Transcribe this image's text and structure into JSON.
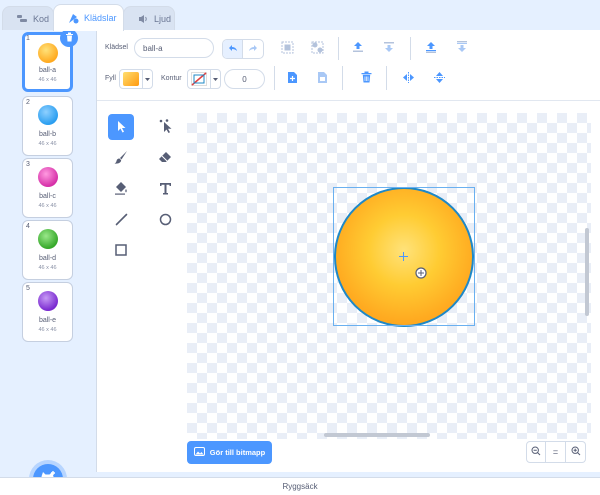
{
  "tabs": [
    {
      "label": "Kod",
      "icon": "code-icon"
    },
    {
      "label": "Klädslar",
      "icon": "costumes-icon"
    },
    {
      "label": "Ljud",
      "icon": "sound-icon"
    }
  ],
  "costumes": [
    {
      "number": "1",
      "name": "ball-a",
      "size": "46 x 46",
      "color": "#ffb21e",
      "selected": true
    },
    {
      "number": "2",
      "name": "ball-b",
      "size": "46 x 46",
      "color": "#3aaaf5",
      "selected": false
    },
    {
      "number": "3",
      "name": "ball-c",
      "size": "46 x 46",
      "color": "#e44ab8",
      "selected": false
    },
    {
      "number": "4",
      "name": "ball-d",
      "size": "46 x 46",
      "color": "#4cc23c",
      "selected": false
    },
    {
      "number": "5",
      "name": "ball-e",
      "size": "46 x 46",
      "color": "#8a3ad8",
      "selected": false
    }
  ],
  "toolbar": {
    "costume_label": "Klädsel",
    "costume_name": "ball-a",
    "fill_label": "Fyll",
    "fill_color": "#ffb21e",
    "outline_label": "Kontur",
    "outline_width": "0"
  },
  "canvas": {
    "convert_button": "Gör till bitmapp",
    "zoom_reset": "="
  },
  "backpack": {
    "label": "Ryggsäck"
  },
  "colors": {
    "accent": "#4c97ff",
    "outline": "#1e88c7"
  }
}
